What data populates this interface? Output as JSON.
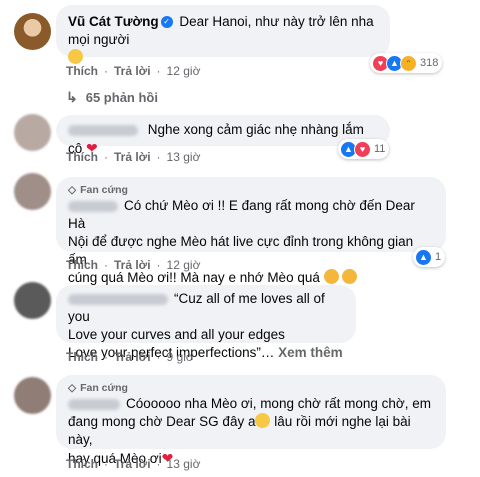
{
  "actions": {
    "like": "Thích",
    "reply": "Trả lời"
  },
  "comments": [
    {
      "author": "Vũ Cát Tường",
      "text": "Dear Hanoi, như này trở lên nha mọi người",
      "time": "12 giờ",
      "reaction_count": "318",
      "reactions": [
        "love-icon",
        "like-icon",
        "haha-icon"
      ]
    },
    {
      "text": "Nghe xong cảm giác nhẹ nhàng lắm cô",
      "time": "13 giờ",
      "reaction_count": "11",
      "reactions": [
        "like-icon",
        "love-icon"
      ]
    },
    {
      "badge": "Fan cứng",
      "text_line1": "Có chứ Mèo ơi !! E đang rất mong chờ đến Dear Hà",
      "text_line2": "Nội để được nghe Mèo hát live cực đỉnh trong không gian ấm",
      "text_line3": "cúng quá Mèo ơi!! Mà nay e nhớ Mèo quá",
      "time": "12 giờ",
      "reaction_count": "1",
      "reactions": [
        "like-icon"
      ]
    },
    {
      "text_line1": "“Cuz all of me loves all of you",
      "text_line2": "Love your curves and all your edges",
      "text_line3": "Love your perfect imperfections”…",
      "see_more": "Xem thêm",
      "time": "9 giờ"
    },
    {
      "badge": "Fan cứng",
      "text_line1": "Cóooooo nha Mèo ơi, mong chờ rất mong chờ, em",
      "text_line2a": "đang mong chờ Dear SG đây a",
      "text_line2b": " lâu rồi mới nghe lại bài này,",
      "text_line3": "hay quá Mèo ơi",
      "time": "13 giờ"
    }
  ],
  "replies": {
    "label": "65 phản hồi"
  },
  "colors": {
    "bubble": "#f0f2f5",
    "link": "#65676b",
    "like": "#1877f2",
    "love": "#f33e58",
    "haha": "#f7b125"
  }
}
